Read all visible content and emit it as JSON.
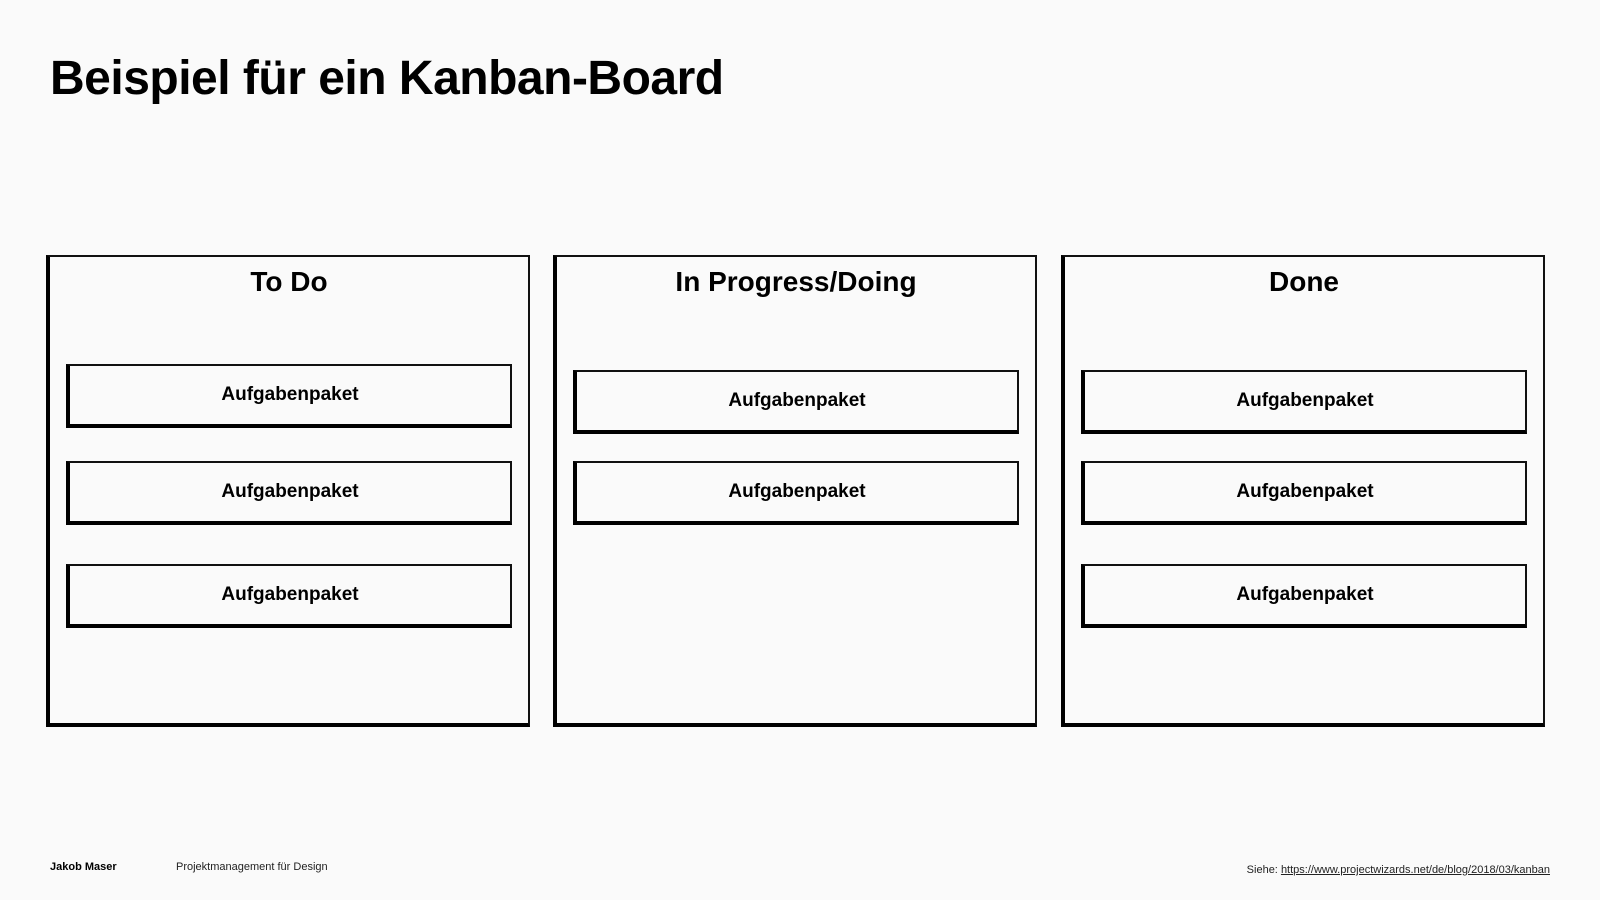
{
  "slide": {
    "title": "Beispiel für ein Kanban-Board"
  },
  "board": {
    "columns": [
      {
        "title": "To Do",
        "cards": [
          "Aufgabenpaket",
          "Aufgabenpaket",
          "Aufgabenpaket"
        ]
      },
      {
        "title": "In Progress/Doing",
        "cards": [
          "Aufgabenpaket",
          "Aufgabenpaket"
        ]
      },
      {
        "title": "Done",
        "cards": [
          "Aufgabenpaket",
          "Aufgabenpaket",
          "Aufgabenpaket"
        ]
      }
    ]
  },
  "footer": {
    "author": "Jakob Maser",
    "course": "Projektmanagement für Design",
    "source_prefix": "Siehe:",
    "source_link": "https://www.projectwizards.net/de/blog/2018/03/kanban"
  }
}
